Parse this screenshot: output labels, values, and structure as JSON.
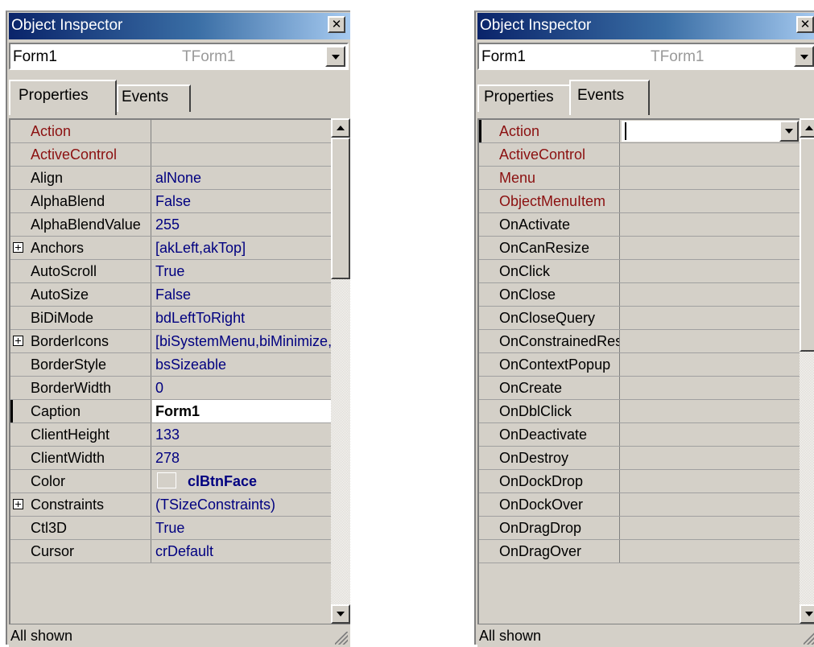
{
  "colors": {
    "titlebar": "#0a246a",
    "face": "#d4d0c8",
    "event_name": "#8b1010",
    "value_text": "#000080"
  },
  "left": {
    "title": "Object Inspector",
    "object_name": "Form1",
    "object_type": "TForm1",
    "tabs": [
      "Properties",
      "Events"
    ],
    "active_tab": "Properties",
    "rows": [
      {
        "name": "Action",
        "value": "",
        "red": true
      },
      {
        "name": "ActiveControl",
        "value": "",
        "red": true
      },
      {
        "name": "Align",
        "value": "alNone"
      },
      {
        "name": "AlphaBlend",
        "value": "False"
      },
      {
        "name": "AlphaBlendValue",
        "value": "255"
      },
      {
        "name": "Anchors",
        "value": "[akLeft,akTop]",
        "expand": true
      },
      {
        "name": "AutoScroll",
        "value": "True"
      },
      {
        "name": "AutoSize",
        "value": "False"
      },
      {
        "name": "BiDiMode",
        "value": "bdLeftToRight"
      },
      {
        "name": "BorderIcons",
        "value": "[biSystemMenu,biMinimize,biMaximize]",
        "expand": true
      },
      {
        "name": "BorderStyle",
        "value": "bsSizeable"
      },
      {
        "name": "BorderWidth",
        "value": "0"
      },
      {
        "name": "Caption",
        "value": "Form1",
        "selected": true
      },
      {
        "name": "ClientHeight",
        "value": "133"
      },
      {
        "name": "ClientWidth",
        "value": "278"
      },
      {
        "name": "Color",
        "value": "clBtnFace",
        "color": true
      },
      {
        "name": "Constraints",
        "value": "(TSizeConstraints)",
        "expand": true
      },
      {
        "name": "Ctl3D",
        "value": "True"
      },
      {
        "name": "Cursor",
        "value": "crDefault"
      }
    ],
    "scroll_position": 0.0,
    "status": "All shown"
  },
  "right": {
    "title": "Object Inspector",
    "object_name": "Form1",
    "object_type": "TForm1",
    "tabs": [
      "Properties",
      "Events"
    ],
    "active_tab": "Events",
    "rows": [
      {
        "name": "Action",
        "value": "",
        "red": true,
        "selected": true
      },
      {
        "name": "ActiveControl",
        "value": "",
        "red": true
      },
      {
        "name": "Menu",
        "value": "",
        "red": true
      },
      {
        "name": "ObjectMenuItem",
        "value": "",
        "red": true
      },
      {
        "name": "OnActivate",
        "value": ""
      },
      {
        "name": "OnCanResize",
        "value": ""
      },
      {
        "name": "OnClick",
        "value": ""
      },
      {
        "name": "OnClose",
        "value": ""
      },
      {
        "name": "OnCloseQuery",
        "value": ""
      },
      {
        "name": "OnConstrainedResize",
        "value": ""
      },
      {
        "name": "OnContextPopup",
        "value": ""
      },
      {
        "name": "OnCreate",
        "value": ""
      },
      {
        "name": "OnDblClick",
        "value": ""
      },
      {
        "name": "OnDeactivate",
        "value": ""
      },
      {
        "name": "OnDestroy",
        "value": ""
      },
      {
        "name": "OnDockDrop",
        "value": ""
      },
      {
        "name": "OnDockOver",
        "value": ""
      },
      {
        "name": "OnDragDrop",
        "value": ""
      },
      {
        "name": "OnDragOver",
        "value": ""
      }
    ],
    "scroll_position": 0.0,
    "status": "All shown"
  }
}
